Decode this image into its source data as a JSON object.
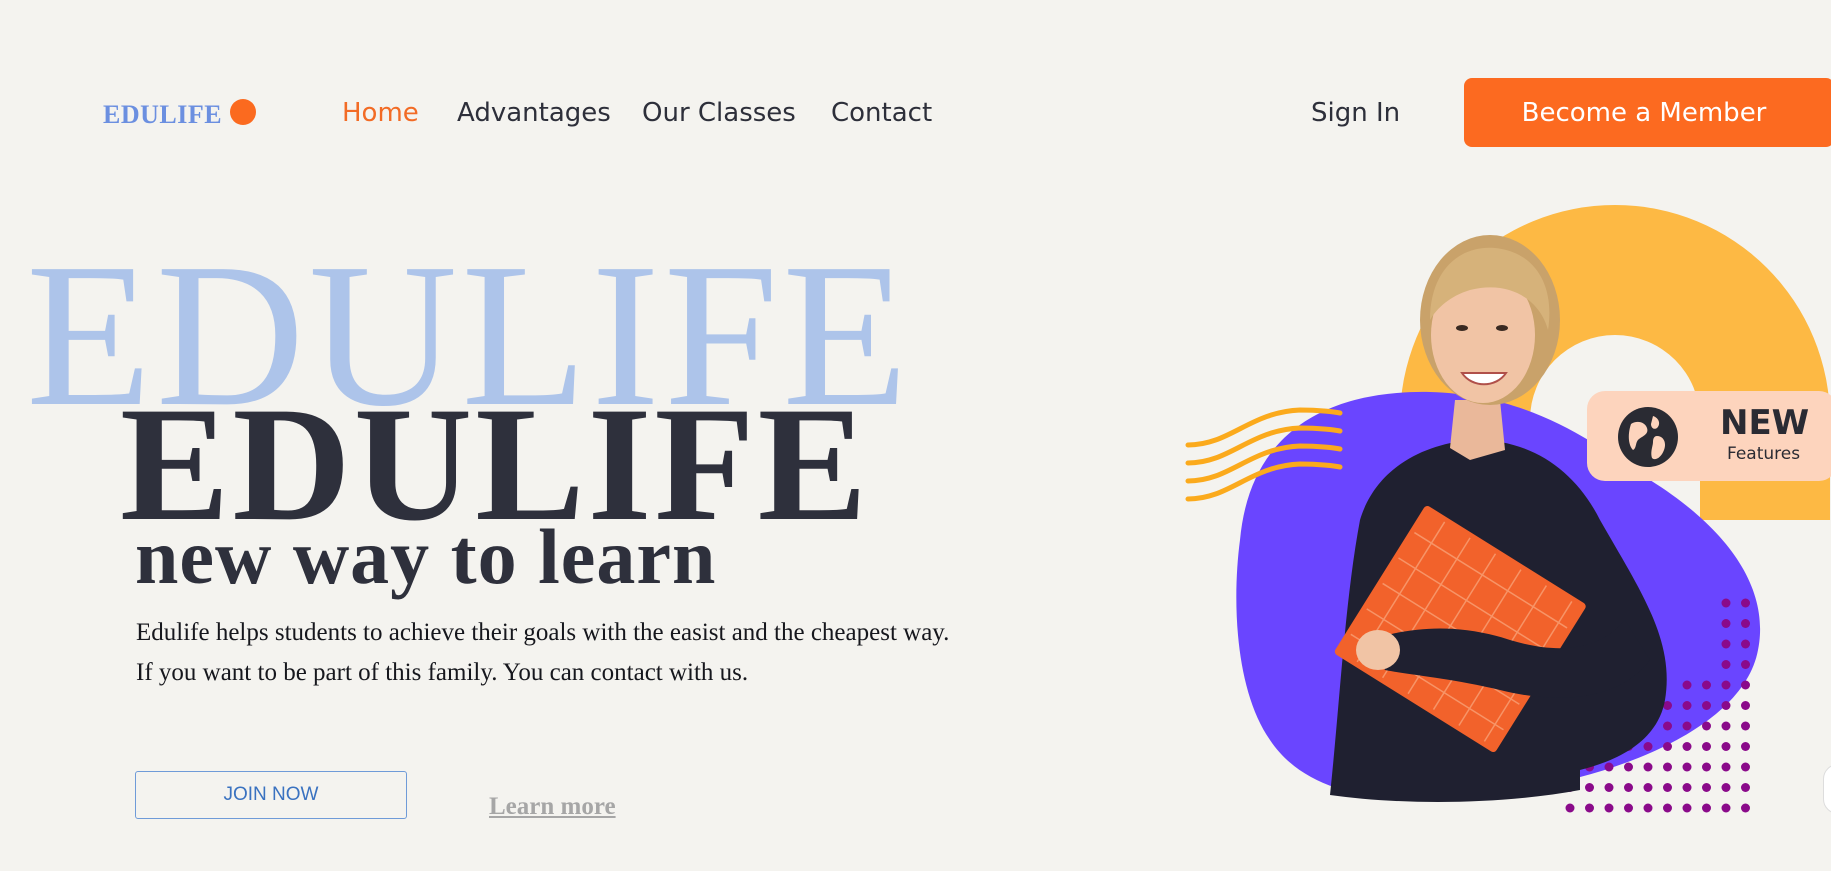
{
  "header": {
    "logo": "EDULIFE",
    "nav": [
      {
        "label": "Home",
        "active": true
      },
      {
        "label": "Advantages",
        "active": false
      },
      {
        "label": "Our Classes",
        "active": false
      },
      {
        "label": "Contact",
        "active": false
      }
    ],
    "sign_in": "Sign In",
    "member_button": "Become a Member"
  },
  "hero": {
    "background_title": "EDULIFE",
    "title": "EDULIFE",
    "tagline": "new way to learn",
    "description_line1": "Edulife helps students to achieve their goals with the easist and the cheapest way.",
    "description_line2": "If you want to be part of this family. You can contact with us.",
    "join_button": "JOIN NOW",
    "learn_more": "Learn more"
  },
  "badge": {
    "title": "NEW",
    "subtitle": "Features",
    "icon": "globe-icon"
  },
  "colors": {
    "background": "#f4f3ef",
    "accent_orange": "#fc6a20",
    "logo_blue": "#6b8fe0",
    "title_blue_light": "#adc4ea",
    "text_dark": "#2e303c",
    "blob_purple": "#6a45ff",
    "arc_yellow": "#fdb944",
    "dots_purple": "#8a0a8a",
    "badge_peach": "#fdd4bd"
  }
}
